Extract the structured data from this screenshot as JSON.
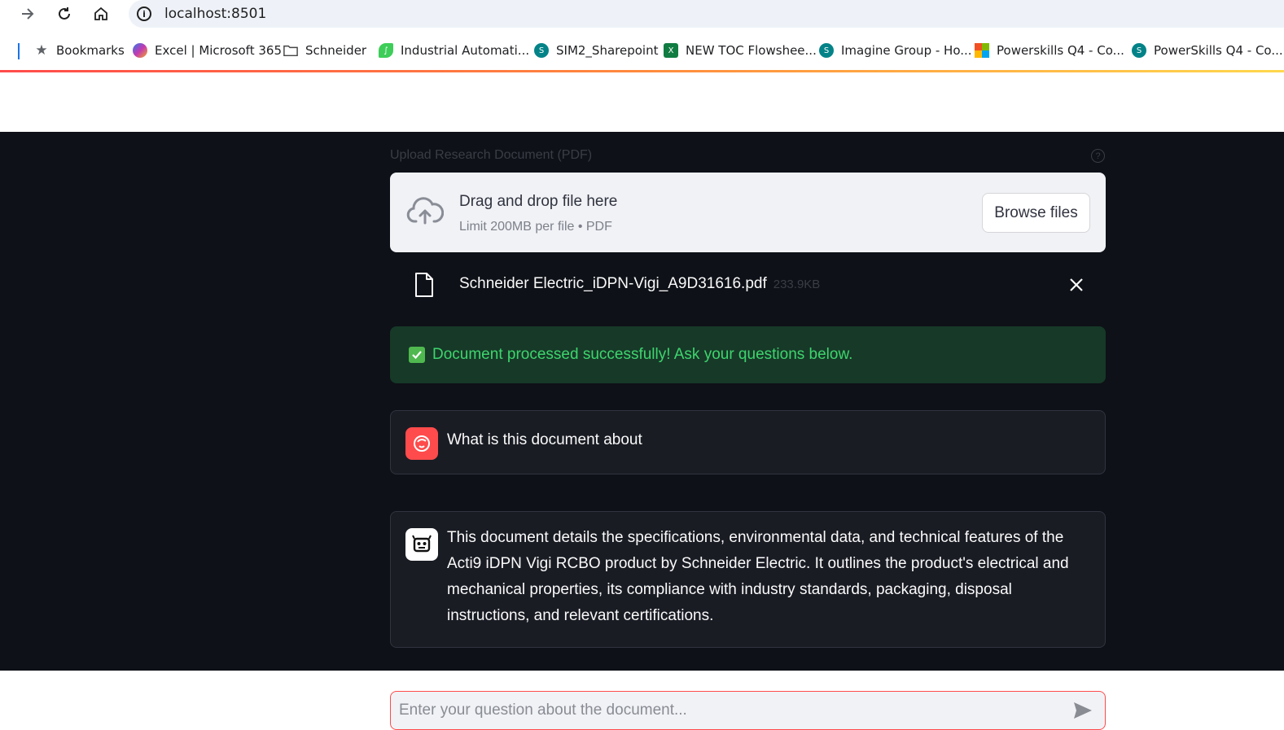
{
  "browser": {
    "url": "localhost:8501",
    "bookmarks": [
      {
        "label": "Bookmarks",
        "icon": "star-icon"
      },
      {
        "label": "Excel | Microsoft 365",
        "icon": "copilot-icon"
      },
      {
        "label": "Schneider",
        "icon": "folder-icon"
      },
      {
        "label": "Industrial Automati...",
        "icon": "schneider-leaf-icon"
      },
      {
        "label": "SIM2_Sharepoint",
        "icon": "sharepoint-icon"
      },
      {
        "label": "NEW TOC Flowshee...",
        "icon": "excel-icon"
      },
      {
        "label": "Imagine Group - Ho...",
        "icon": "sharepoint-icon"
      },
      {
        "label": "Powerskills Q4 - Co...",
        "icon": "microsoft-icon"
      },
      {
        "label": "PowerSkills Q4 - Co...",
        "icon": "sharepoint-icon"
      }
    ]
  },
  "uploader": {
    "label": "Upload Research Document (PDF)",
    "drop_title": "Drag and drop file here",
    "drop_subtitle": "Limit 200MB per file • PDF",
    "browse_label": "Browse files"
  },
  "file": {
    "name": "Schneider Electric_iDPN-Vigi_A9D31616.pdf",
    "size": "233.9KB"
  },
  "status": {
    "message": "Document processed successfully! Ask your questions below."
  },
  "chat": {
    "user_message": "What is this document about",
    "assistant_message": "This document details the specifications, environmental data, and technical features of the Acti9 iDPN Vigi RCBO product by Schneider Electric. It outlines the product's electrical and mechanical properties, its compliance with industry standards, packaging, disposal instructions, and relevant certifications."
  },
  "input": {
    "placeholder": "Enter your question about the document..."
  },
  "colors": {
    "accent": "#ff4b4b",
    "app_bg": "#0e1117",
    "success_bg": "#173928",
    "success_text": "#3dd56d"
  }
}
